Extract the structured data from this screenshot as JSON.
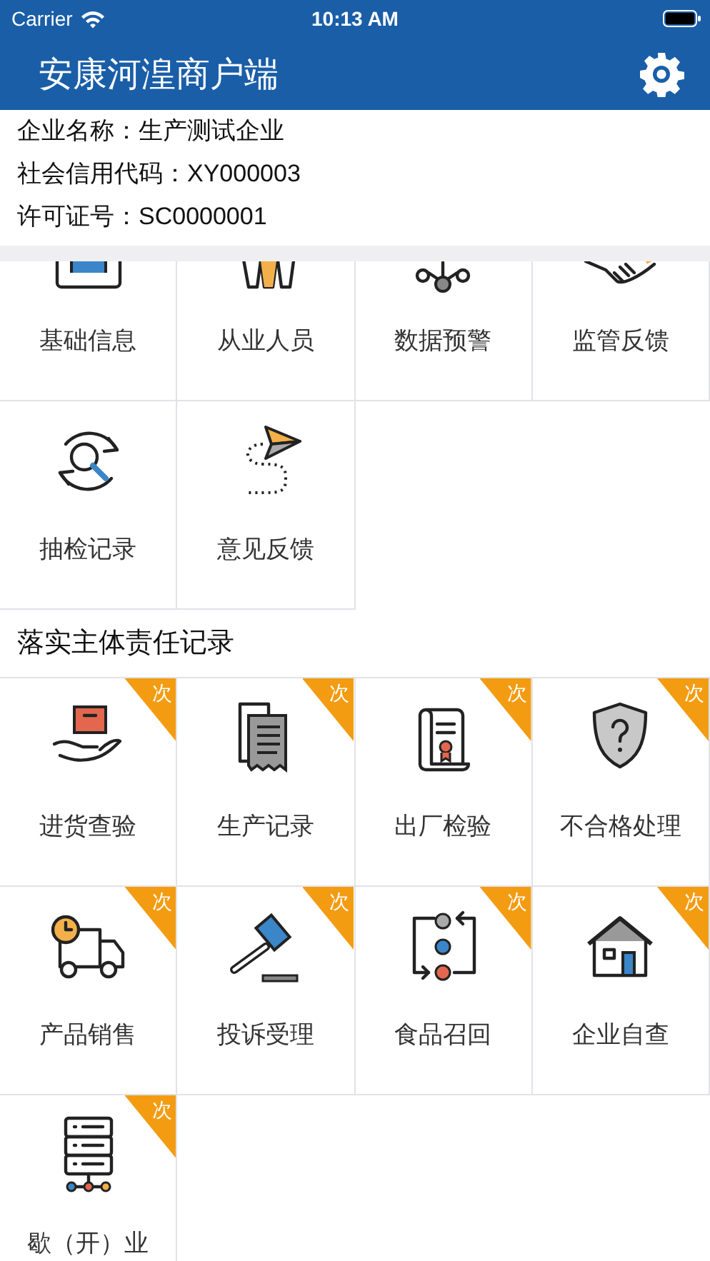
{
  "status_bar": {
    "carrier": "Carrier",
    "time": "10:13 AM"
  },
  "nav_bar": {
    "title": "安康河湟商户端"
  },
  "company": [
    {
      "label": "企业名称：",
      "value": "生产测试企业"
    },
    {
      "label": "社会信用代码：",
      "value": "XY000003"
    },
    {
      "label": "许可证号：",
      "value": "SC0000001"
    }
  ],
  "sections": [
    {
      "items": [
        {
          "label": "基础信息"
        },
        {
          "label": "从业人员"
        },
        {
          "label": "数据预警"
        },
        {
          "label": "监管反馈"
        },
        {
          "label": "抽检记录"
        },
        {
          "label": "意见反馈"
        }
      ]
    },
    {
      "title": "落实主体责任记录",
      "items": [
        {
          "label": "进货查验",
          "badge": "次"
        },
        {
          "label": "生产记录",
          "badge": "次"
        },
        {
          "label": "出厂检验",
          "badge": "次"
        },
        {
          "label": "不合格处理",
          "badge": "次"
        },
        {
          "label": "产品销售",
          "badge": "次"
        },
        {
          "label": "投诉受理",
          "badge": "次"
        },
        {
          "label": "食品召回",
          "badge": "次"
        },
        {
          "label": "企业自查",
          "badge": "次"
        },
        {
          "label": "歇（开）业",
          "badge": "次"
        }
      ]
    }
  ]
}
